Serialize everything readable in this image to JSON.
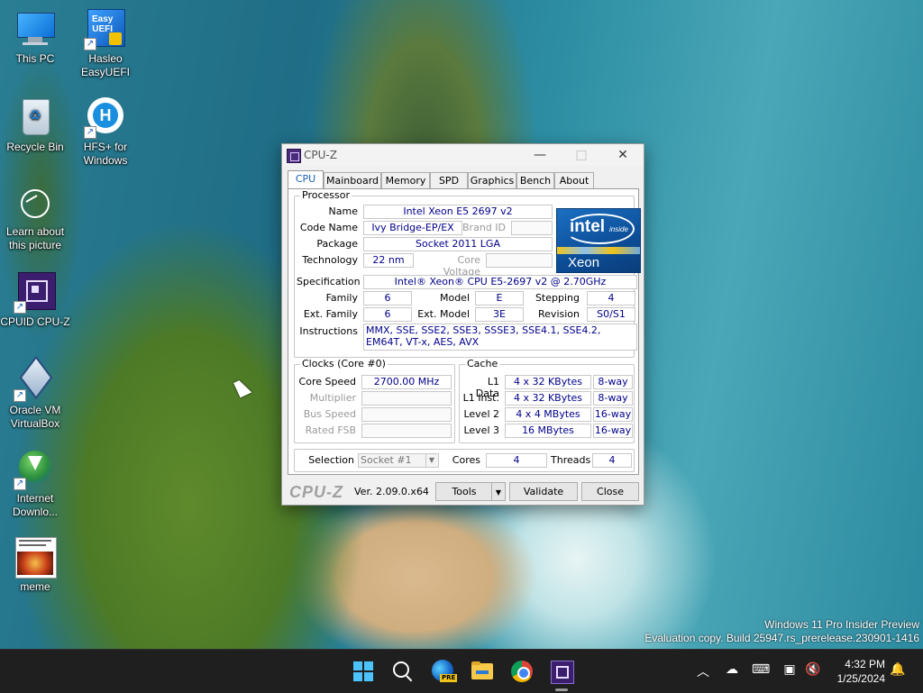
{
  "desktop": {
    "icons": [
      {
        "label": "This PC",
        "icon": "monitor-icon"
      },
      {
        "label": "Recycle Bin",
        "icon": "recycle-bin-icon"
      },
      {
        "label": "Learn about this picture",
        "icon": "camera-icon"
      },
      {
        "label": "CPUID CPU-Z",
        "icon": "cpuz-icon"
      },
      {
        "label": "Oracle VM VirtualBox",
        "icon": "virtualbox-icon"
      },
      {
        "label": "Internet Downlo...",
        "icon": "download-manager-icon"
      },
      {
        "label": "meme",
        "icon": "image-file-icon"
      },
      {
        "label": "Hasleo EasyUEFI",
        "icon": "easyuefi-icon"
      },
      {
        "label": "HFS+ for Windows",
        "icon": "hfs-icon"
      }
    ],
    "watermark_line1": "Windows 11 Pro Insider Preview",
    "watermark_line2": "Evaluation copy. Build 25947.rs_prerelease.230901-1416"
  },
  "window": {
    "title": "CPU-Z",
    "tabs": [
      "CPU",
      "Mainboard",
      "Memory",
      "SPD",
      "Graphics",
      "Bench",
      "About"
    ],
    "active_tab": "CPU",
    "processor": {
      "group_title": "Processor",
      "name_label": "Name",
      "name": "Intel Xeon E5 2697 v2",
      "codename_label": "Code Name",
      "codename": "Ivy Bridge-EP/EX",
      "brandid_label": "Brand ID",
      "brandid": "",
      "package_label": "Package",
      "package": "Socket 2011 LGA",
      "technology_label": "Technology",
      "technology": "22 nm",
      "corevoltage_label": "Core Voltage",
      "corevoltage": "",
      "specification_label": "Specification",
      "specification": "Intel® Xeon® CPU E5-2697 v2 @ 2.70GHz",
      "family_label": "Family",
      "family": "6",
      "model_label": "Model",
      "model": "E",
      "stepping_label": "Stepping",
      "stepping": "4",
      "extfamily_label": "Ext. Family",
      "extfamily": "6",
      "extmodel_label": "Ext. Model",
      "extmodel": "3E",
      "revision_label": "Revision",
      "revision": "S0/S1",
      "instructions_label": "Instructions",
      "instructions": "MMX, SSE, SSE2, SSE3, SSSE3, SSE4.1, SSE4.2, EM64T, VT-x, AES, AVX",
      "logo_brand": "intel",
      "logo_inside": "inside",
      "logo_product": "Xeon"
    },
    "clocks": {
      "group_title": "Clocks (Core #0)",
      "corespeed_label": "Core Speed",
      "corespeed": "2700.00 MHz",
      "multiplier_label": "Multiplier",
      "multiplier": "",
      "busspeed_label": "Bus Speed",
      "busspeed": "",
      "ratedfsb_label": "Rated FSB",
      "ratedfsb": ""
    },
    "cache": {
      "group_title": "Cache",
      "rows": [
        {
          "label": "L1 Data",
          "size": "4 x 32 KBytes",
          "ways": "8-way"
        },
        {
          "label": "L1 Inst.",
          "size": "4 x 32 KBytes",
          "ways": "8-way"
        },
        {
          "label": "Level 2",
          "size": "4 x 4 MBytes",
          "ways": "16-way"
        },
        {
          "label": "Level 3",
          "size": "16 MBytes",
          "ways": "16-way"
        }
      ]
    },
    "selection": {
      "label": "Selection",
      "value": "Socket #1",
      "cores_label": "Cores",
      "cores": "4",
      "threads_label": "Threads",
      "threads": "4"
    },
    "footer": {
      "brand": "CPU-Z",
      "version": "Ver. 2.09.0.x64",
      "tools_label": "Tools",
      "validate_label": "Validate",
      "close_label": "Close"
    }
  },
  "taskbar": {
    "clock_time": "4:32 PM",
    "clock_date": "1/25/2024",
    "apps": [
      "windows-start-icon",
      "search-icon",
      "edge-beta-icon",
      "file-explorer-icon",
      "chrome-icon",
      "cpuz-icon"
    ],
    "edge_badge": "PRE"
  }
}
